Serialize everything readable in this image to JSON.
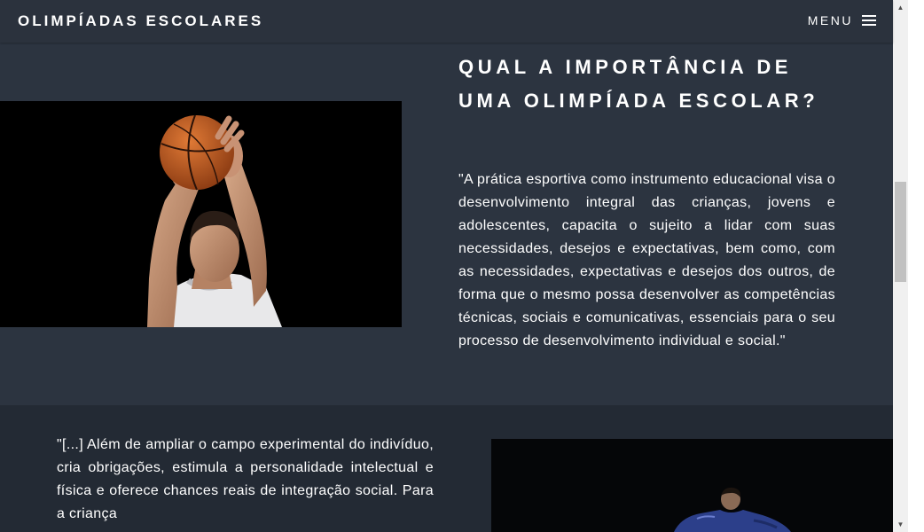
{
  "navbar": {
    "brand": "OLIMPÍADAS ESCOLARES",
    "menu_label": "MENU",
    "menu_icon": "hamburger-icon"
  },
  "section_importance": {
    "heading": "QUAL A IMPORTÂNCIA DE UMA OLIMPÍADA ESCOLAR?",
    "quote": "\"A prática esportiva como instrumento educacional visa o desenvolvimento integral das crianças, jovens e adolescentes, capacita o sujeito a lidar com suas necessidades, desejos e expectativas, bem como, com as necessidades, expectativas e desejos dos outros, de forma que o mesmo possa desenvolver as competências técnicas, sociais e comunicativas, essenciais para o seu processo de desenvolvimento individual e social.\"",
    "image": "basketball-player-photo"
  },
  "section_benefits": {
    "quote": "\"[...] Além de ampliar o campo experimental do indivíduo, cria obrigações, estimula a personalidade intelectual e física e oferece chances reais de integração social. Para a criança",
    "image": "athlete-photo"
  },
  "scrollbar": {
    "up_icon": "scroll-up-arrow-icon",
    "down_icon": "scroll-down-arrow-icon"
  },
  "colors": {
    "navbar": "#2b323d",
    "section_light": "#2c3440",
    "section_dark": "#232a34",
    "text": "#ffffff"
  }
}
